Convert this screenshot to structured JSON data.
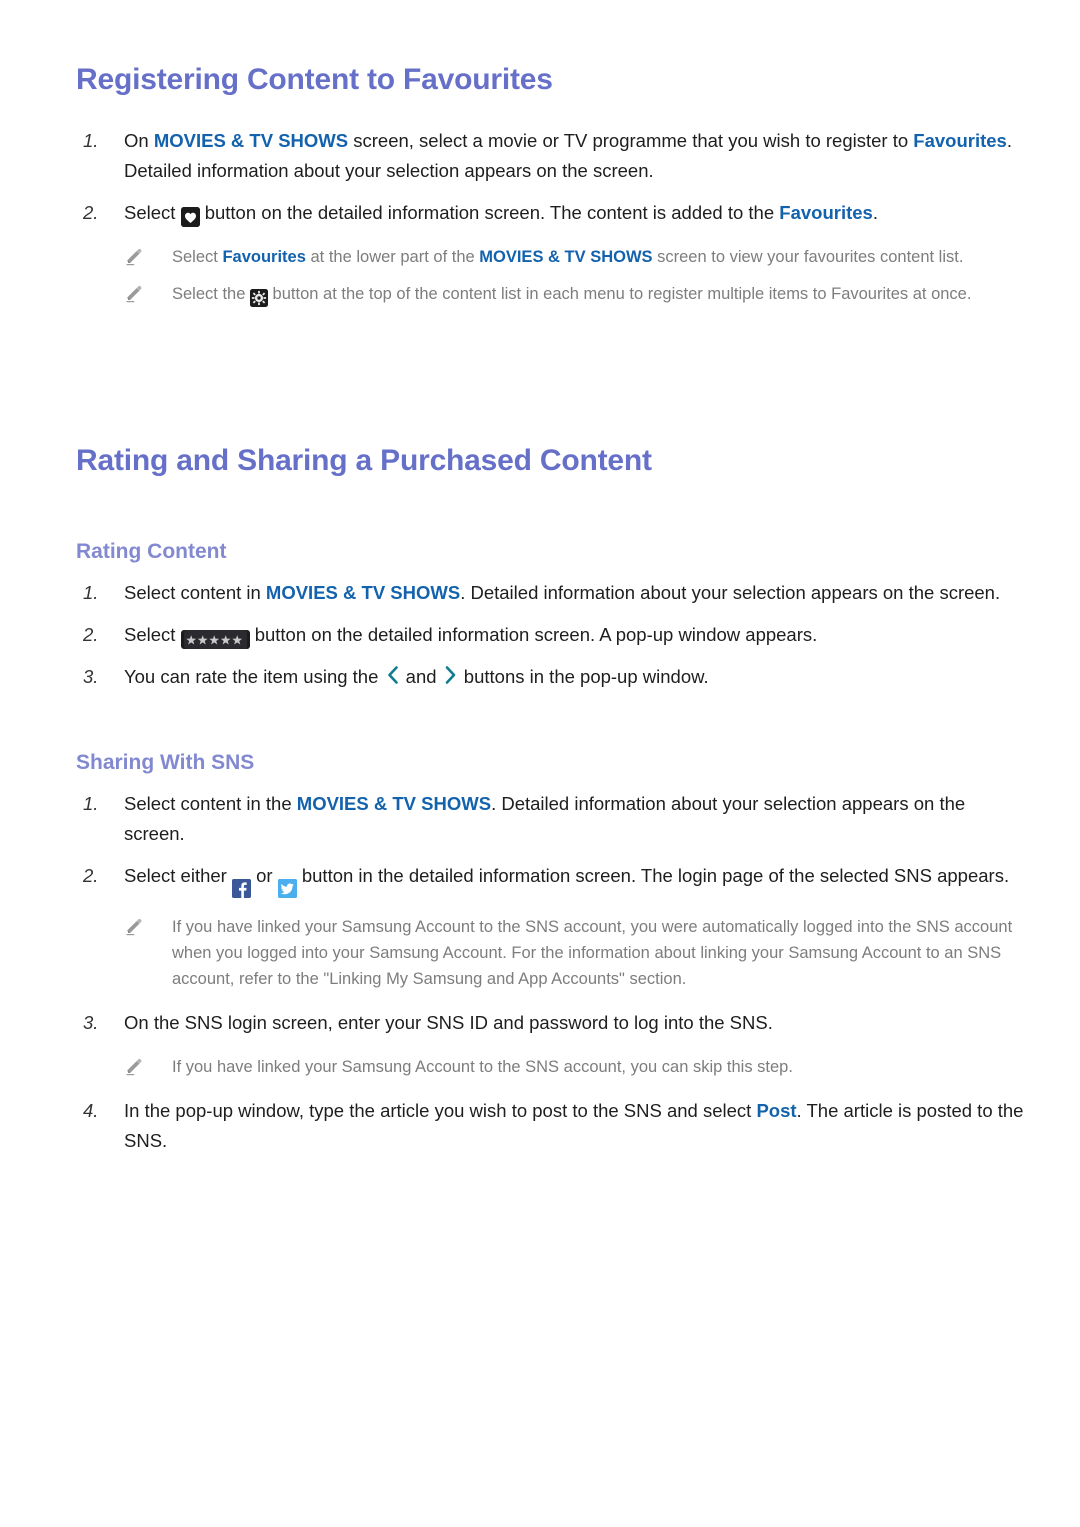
{
  "sections": [
    {
      "id": "registering",
      "heading": "Registering Content to Favourites",
      "steps": [
        {
          "num": "1.",
          "parts": [
            {
              "t": "text",
              "v": "On "
            },
            {
              "t": "kw",
              "v": "MOVIES & TV SHOWS"
            },
            {
              "t": "text",
              "v": " screen, select a movie or TV programme that you wish to register to "
            },
            {
              "t": "kw",
              "v": "Favourites"
            },
            {
              "t": "text",
              "v": ". Detailed information about your selection appears on the screen."
            }
          ]
        },
        {
          "num": "2.",
          "parts": [
            {
              "t": "text",
              "v": "Select "
            },
            {
              "t": "icon",
              "v": "heart-key-button"
            },
            {
              "t": "text",
              "v": " button on the detailed information screen. The content is added to the "
            },
            {
              "t": "kw",
              "v": "Favourites"
            },
            {
              "t": "text",
              "v": "."
            }
          ]
        }
      ],
      "notes": [
        {
          "icon": "pencil-icon",
          "parts": [
            {
              "t": "text",
              "v": "Select "
            },
            {
              "t": "kw",
              "v": "Favourites"
            },
            {
              "t": "text",
              "v": " at the lower part of the "
            },
            {
              "t": "kw",
              "v": "MOVIES & TV SHOWS"
            },
            {
              "t": "text",
              "v": " screen to view your favourites content list."
            }
          ]
        },
        {
          "icon": "pencil-icon",
          "parts": [
            {
              "t": "text",
              "v": "Select the "
            },
            {
              "t": "icon",
              "v": "gear-key-button"
            },
            {
              "t": "text",
              "v": " button at the top of the content list in each menu to register multiple items to Favourites at once."
            }
          ]
        }
      ]
    },
    {
      "id": "rating-sharing",
      "heading": "Rating and Sharing a Purchased Content",
      "subsections": [
        {
          "id": "rating-content",
          "heading": "Rating Content",
          "steps": [
            {
              "num": "1.",
              "parts": [
                {
                  "t": "text",
                  "v": "Select content in "
                },
                {
                  "t": "kw",
                  "v": "MOVIES & TV SHOWS"
                },
                {
                  "t": "text",
                  "v": ". Detailed information about your selection appears on the screen."
                }
              ]
            },
            {
              "num": "2.",
              "parts": [
                {
                  "t": "text",
                  "v": "Select "
                },
                {
                  "t": "icon",
                  "v": "five-stars-key-button"
                },
                {
                  "t": "text",
                  "v": " button on the detailed information screen. A pop-up window appears."
                }
              ]
            },
            {
              "num": "3.",
              "parts": [
                {
                  "t": "text",
                  "v": "You can rate the item using the "
                },
                {
                  "t": "icon",
                  "v": "chevron-left-icon"
                },
                {
                  "t": "text",
                  "v": " and "
                },
                {
                  "t": "icon",
                  "v": "chevron-right-icon"
                },
                {
                  "t": "text",
                  "v": " buttons in the pop-up window."
                }
              ]
            }
          ]
        },
        {
          "id": "sharing-with-sns",
          "heading": "Sharing With SNS",
          "steps": [
            {
              "num": "1.",
              "parts": [
                {
                  "t": "text",
                  "v": "Select content in the "
                },
                {
                  "t": "kw",
                  "v": "MOVIES & TV SHOWS"
                },
                {
                  "t": "text",
                  "v": ". Detailed information about your selection appears on the screen."
                }
              ]
            },
            {
              "num": "2.",
              "parts": [
                {
                  "t": "text",
                  "v": "Select either "
                },
                {
                  "t": "icon",
                  "v": "facebook-icon"
                },
                {
                  "t": "text",
                  "v": " or "
                },
                {
                  "t": "icon",
                  "v": "twitter-icon"
                },
                {
                  "t": "text",
                  "v": " button in the detailed information screen. The login page of the selected SNS appears."
                }
              ]
            },
            {
              "num": "3.",
              "parts": [
                {
                  "t": "text",
                  "v": "On the SNS login screen, enter your SNS ID and password to log into the SNS."
                }
              ]
            },
            {
              "num": "4.",
              "parts": [
                {
                  "t": "text",
                  "v": "In the pop-up window, type the article you wish to post to the SNS and select "
                },
                {
                  "t": "kw",
                  "v": "Post"
                },
                {
                  "t": "text",
                  "v": ". The article is posted to the SNS."
                }
              ]
            }
          ],
          "notes_after_step2": [
            {
              "icon": "pencil-icon",
              "parts": [
                {
                  "t": "text",
                  "v": "If you have linked your Samsung Account to the SNS account, you were automatically logged into the SNS account when you logged into your Samsung Account. For the information about linking your Samsung Account to an SNS account, refer to the \"Linking My Samsung and App Accounts\" section."
                }
              ]
            }
          ],
          "notes_after_step3": [
            {
              "icon": "pencil-icon",
              "parts": [
                {
                  "t": "text",
                  "v": "If you have linked your Samsung Account to the SNS account, you can skip this step."
                }
              ]
            }
          ]
        }
      ]
    }
  ],
  "colors": {
    "heading_primary": "#6670c8",
    "heading_secondary": "#8289d0",
    "keyword_blue": "#1362ad",
    "body_text": "#1e1e1e",
    "note_text": "#7d7d7d",
    "chevron_teal": "#117c8f",
    "key_button_dark": "#1c1c1c",
    "facebook_blue": "#3b5998",
    "twitter_blue": "#4aafec"
  }
}
